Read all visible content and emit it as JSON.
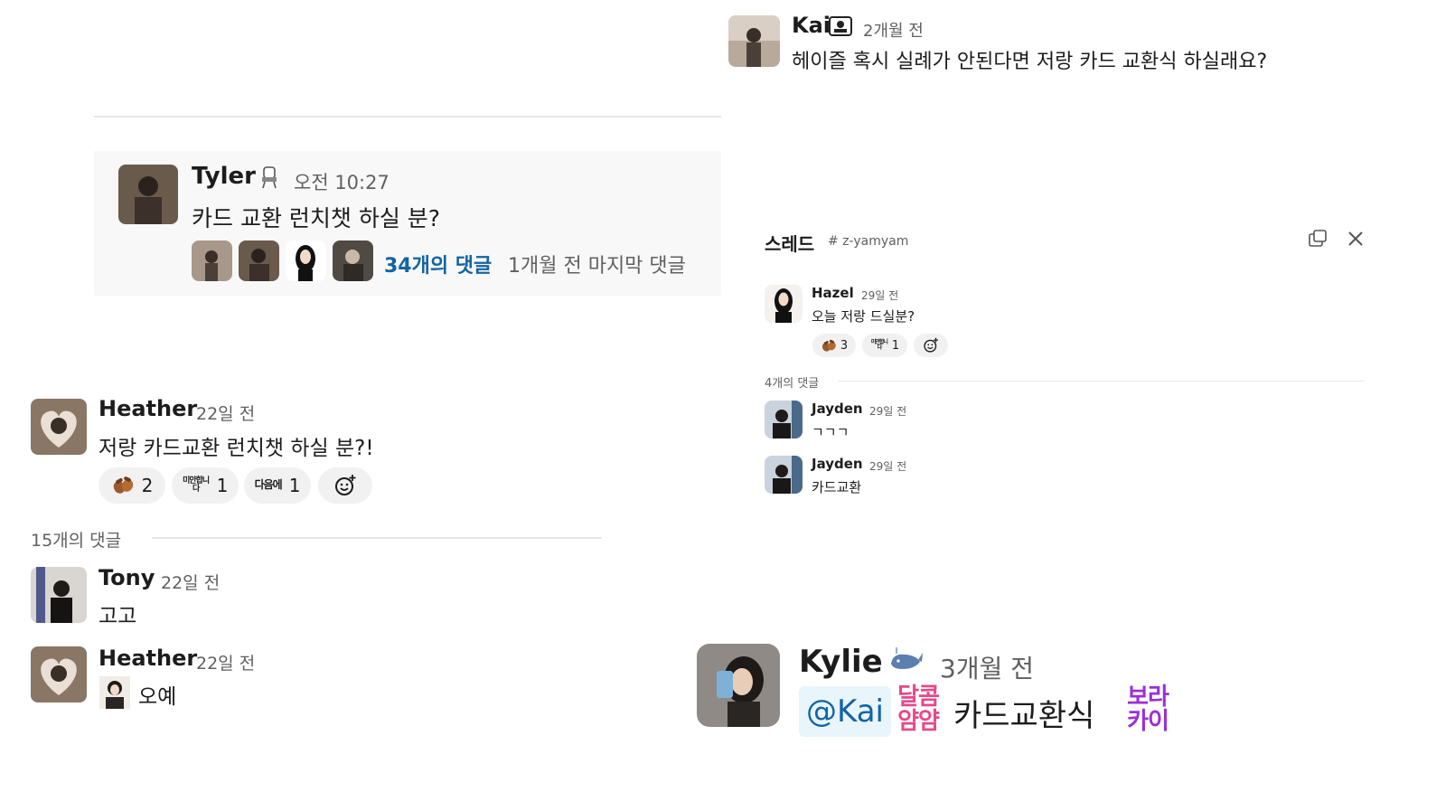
{
  "kai_top": {
    "name": "Kai",
    "time": "2개월 전",
    "message": "헤이즐 혹시 실례가 안된다면 저랑 카드 교환식 하실래요?"
  },
  "tyler_card": {
    "name": "Tyler",
    "time": "오전 10:27",
    "message": "카드 교환 런치챗 하실 분?",
    "reply_count": "34개의 댓글",
    "last_reply": "1개월 전 마지막 댓글"
  },
  "heather_thread": {
    "parent": {
      "name": "Heather",
      "time": "22일 전",
      "message": "저랑 카드교환 런치챗 하실 분?!",
      "reactions": [
        {
          "emoji": "acorns",
          "count": "2"
        },
        {
          "emoji": "미안합니다",
          "count": "1"
        },
        {
          "emoji": "다음에",
          "count": "1"
        }
      ]
    },
    "reply_count": "15개의 댓글",
    "replies": [
      {
        "name": "Tony",
        "time": "22일 전",
        "message": "고고"
      },
      {
        "name": "Heather",
        "time": "22일 전",
        "message": "오예"
      }
    ]
  },
  "thread_panel": {
    "title": "스레드",
    "channel": "# z-yamyam",
    "parent": {
      "name": "Hazel",
      "time": "29일 전",
      "message": "오늘 저랑 드실분?",
      "reactions": [
        {
          "emoji": "acorns",
          "count": "3"
        },
        {
          "emoji": "미안합니다",
          "count": "1"
        }
      ]
    },
    "reply_count": "4개의 댓글",
    "replies": [
      {
        "name": "Jayden",
        "time": "29일 전",
        "message": "ㄱㄱㄱ"
      },
      {
        "name": "Jayden",
        "time": "29일 전",
        "message": "카드교환"
      }
    ]
  },
  "kylie": {
    "name": "Kylie",
    "time": "3개월 전",
    "mention": "@Kai",
    "emoji_dalkom": "달콤얌얌",
    "text": "카드교환식",
    "emoji_bora": "보라카이"
  },
  "colors": {
    "link": "#1264a3",
    "mention_bg": "#e8f5fa",
    "mention_text": "#1264a3",
    "reaction_bg": "#f1f1f1",
    "card_bg": "#f8f8f8",
    "pink_emoji": "#e8488a",
    "purple_emoji": "#9b2fd6"
  }
}
